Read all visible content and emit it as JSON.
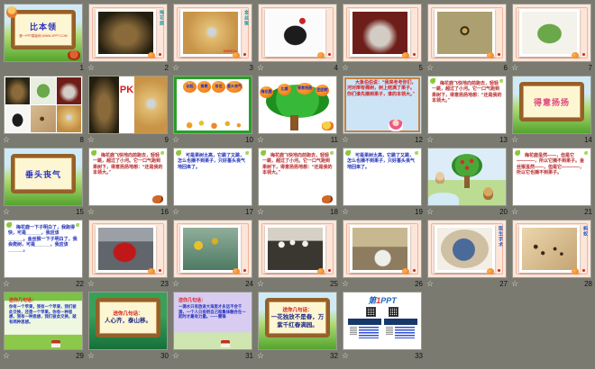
{
  "icons": {
    "transition_star": "☆"
  },
  "slides": [
    {
      "n": "1",
      "title": "比本领",
      "subtitle": "第一PPT模板网 WWW.1PPT.COM"
    },
    {
      "n": "2",
      "label": "梅花鹿"
    },
    {
      "n": "3",
      "label": "金丝猴",
      "watermark": "XINHUA"
    },
    {
      "n": "4"
    },
    {
      "n": "5"
    },
    {
      "n": "6"
    },
    {
      "n": "7"
    },
    {
      "n": "8"
    },
    {
      "n": "9",
      "pk": "PK"
    },
    {
      "n": "10",
      "fruits": [
        "驮起",
        "摘果",
        "拾住",
        "垂头丧气"
      ]
    },
    {
      "n": "11",
      "fruits": [
        "梅花鹿",
        "比赛",
        "得意扬扬",
        "团团转"
      ]
    },
    {
      "n": "12",
      "text": "大象伯伯说：“我来考考你们，河对岸有棵树，树上结满了果子。你们谁先摘到果子，谁的本领大。”"
    },
    {
      "n": "13",
      "text": "梅花鹿飞快地向前跑去，轻轻一跳，越过了小河。它一口气跑到果树下，得意扬扬地想：“还是我的本领大。”"
    },
    {
      "n": "14",
      "title": "得意扬扬"
    },
    {
      "n": "15",
      "title": "垂头丧气"
    },
    {
      "n": "16",
      "text": "梅花鹿飞快地向前跑去，轻轻一跳，越过了小河。它一口气跑到果树下，得意扬扬地想：“还是我的本领大。”"
    },
    {
      "n": "17",
      "text": "可是果树太高，它跳了又跳，怎么也摘不到果子，只好垂头丧气地回来了。"
    },
    {
      "n": "18",
      "text": "梅花鹿飞快地向前跑去，轻轻一跳，越过了小河。它一口气跑到果树下，得意扬扬地想：“还是我的本领大。”"
    },
    {
      "n": "19",
      "text": "可是果树太高，它跳了又跳，怎么也摘不到果子，只好垂头丧气地回来了。"
    },
    {
      "n": "20"
    },
    {
      "n": "21",
      "text": "梅花鹿虽然——，但是它————，所以它摘不到果子。金丝猴虽然——，但是它————，所以它也摘不到果子。"
    },
    {
      "n": "22",
      "text": "梅花鹿一下子明白了，我跑得快，可是______，我应该______。金丝猴一下子明白了，我会爬树，可是______，我应该______。"
    },
    {
      "n": "23"
    },
    {
      "n": "24"
    },
    {
      "n": "25"
    },
    {
      "n": "26"
    },
    {
      "n": "27",
      "label": "医生手术"
    },
    {
      "n": "28",
      "label": "蚂蚁"
    },
    {
      "n": "29",
      "title": "送你几句话：",
      "text": "你有一个苹果，我有一个苹果，我们彼此交换，还是一个苹果。你有一种思想，我有一种思想，我们彼此交换，就有两种思想。"
    },
    {
      "n": "30",
      "title": "送你几句话：",
      "text": "人心齐，泰山移。"
    },
    {
      "n": "31",
      "title": "送你几句话：",
      "text": "一滴水只有放进大海里才永远不会干涸，一个人只有把自己和集体融合在一起时才最有力量。——雷锋"
    },
    {
      "n": "32",
      "title": "送你几句话：",
      "text": "一花独放不是春，万紫千红春满园。"
    },
    {
      "n": "33",
      "logo_prefix": "第",
      "logo_num": "1",
      "logo_suffix": "PPT"
    }
  ]
}
